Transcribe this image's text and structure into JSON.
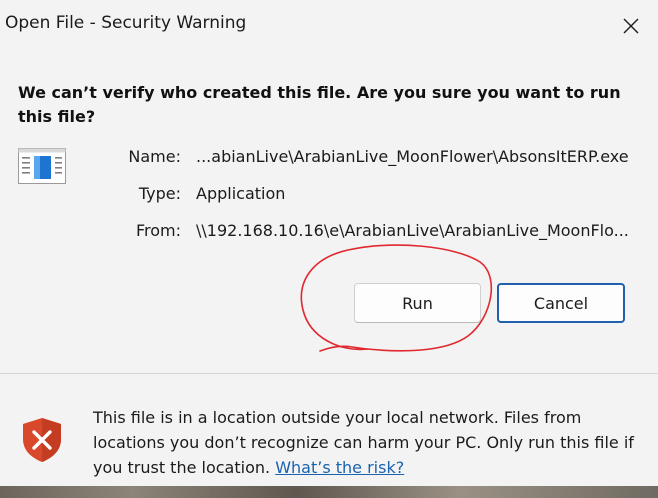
{
  "window": {
    "title": "Open File - Security Warning"
  },
  "dialog": {
    "question": "We can’t verify who created this file. Are you sure you want to run this file?",
    "fields": [
      {
        "label": "Name:",
        "value": "...abianLive\\ArabianLive_MoonFlower\\AbsonsItERP.exe"
      },
      {
        "label": "Type:",
        "value": "Application"
      },
      {
        "label": "From:",
        "value": "\\\\192.168.10.16\\e\\ArabianLive\\ArabianLive_MoonFlo..."
      }
    ],
    "buttons": {
      "run_label": "Run",
      "cancel_label": "Cancel"
    }
  },
  "footer": {
    "warning_text": "This file is in a location outside your local network. Files from locations you don’t recognize can harm your PC. Only run this file if you trust the location.",
    "link_text": "What’s the risk?"
  },
  "colors": {
    "accent": "#1f5fad",
    "link": "#1a63b0",
    "shield": "#d9482b",
    "annotation": "#e0282f"
  },
  "icons": {
    "close": "close-icon",
    "file": "application-file-icon",
    "shield": "shield-warning-icon"
  }
}
